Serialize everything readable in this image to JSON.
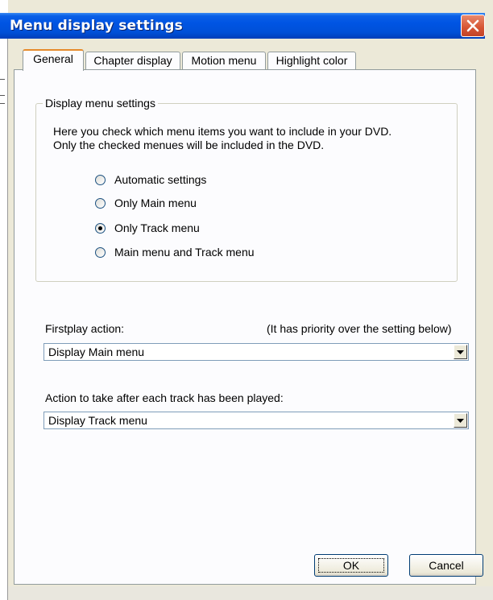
{
  "window": {
    "title": "Menu display settings"
  },
  "tabs": [
    {
      "label": "General",
      "active": true
    },
    {
      "label": "Chapter display",
      "active": false
    },
    {
      "label": "Motion menu",
      "active": false
    },
    {
      "label": "Highlight color",
      "active": false
    }
  ],
  "display_group": {
    "legend": "Display menu settings",
    "description_line1": "Here you check which menu items you want to include in your DVD.",
    "description_line2": "Only the checked menues will be included in the DVD.",
    "options": [
      {
        "label": "Automatic settings",
        "checked": false
      },
      {
        "label": "Only Main menu",
        "checked": false
      },
      {
        "label": "Only Track menu",
        "checked": true
      },
      {
        "label": "Main menu and Track menu",
        "checked": false
      }
    ]
  },
  "firstplay": {
    "label": "Firstplay action:",
    "note": "(It has priority over the setting below)",
    "value": "Display Main menu"
  },
  "after_track": {
    "label": "Action to take after each track has been played:",
    "value": "Display Track menu"
  },
  "buttons": {
    "ok": "OK",
    "cancel": "Cancel"
  }
}
